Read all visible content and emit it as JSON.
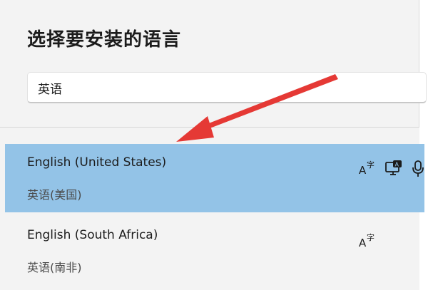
{
  "dialog": {
    "title": "选择要安装的语言"
  },
  "search": {
    "value": "英语"
  },
  "languages": [
    {
      "name": "English (United States)",
      "native": "英语(美国)",
      "selected": true,
      "features": [
        "text-language-icon",
        "display-language-icon",
        "speech-icon"
      ]
    },
    {
      "name": "English (South Africa)",
      "native": "英语(南非)",
      "selected": false,
      "features": [
        "text-language-icon"
      ]
    }
  ],
  "colors": {
    "selected_row": "#93c3e7",
    "arrow": "#e53935",
    "background": "#f3f3f3"
  }
}
